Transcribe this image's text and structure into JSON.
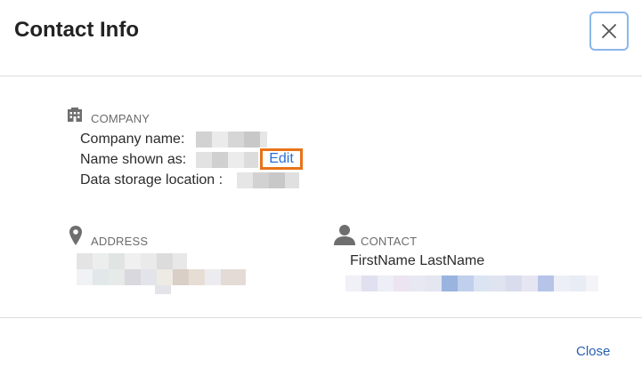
{
  "dialog": {
    "title": "Contact Info",
    "close_icon": "close-icon"
  },
  "company": {
    "icon": "building-icon",
    "section_label": "COMPANY",
    "company_name_label": "Company name:",
    "name_shown_as_label": "Name shown as:",
    "edit_label": "Edit",
    "data_storage_label": "Data storage location :"
  },
  "address": {
    "icon": "location-pin-icon",
    "section_label": "ADDRESS"
  },
  "contact": {
    "icon": "person-icon",
    "section_label": "CONTACT",
    "name": "FirstName LastName"
  },
  "footer": {
    "close_label": "Close"
  },
  "colors": {
    "accent_link": "#2a6fd6",
    "highlight_border": "#e8731a",
    "focus_border": "#8ab7ea"
  }
}
